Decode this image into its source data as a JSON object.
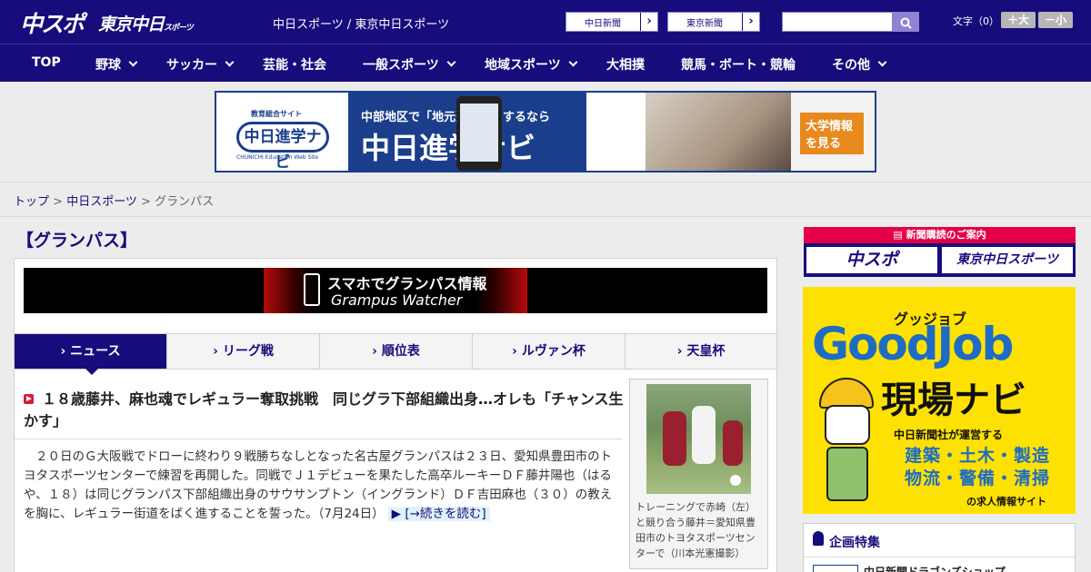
{
  "header": {
    "logo_chuspo": "中スポ",
    "logo_tokyo": "東京中日",
    "logo_tokyo_small": "スポーツ",
    "title": "中日スポーツ / 東京中日スポーツ",
    "btn_chunichi": "中日新聞",
    "btn_tokyo": "東京新聞",
    "arrow": "›",
    "search_placeholder": "",
    "moji_label": "文字（0）",
    "font_plus": "＋大",
    "font_minus": "－小"
  },
  "nav": {
    "items": [
      {
        "label": "TOP"
      },
      {
        "label": "野球"
      },
      {
        "label": "サッカー"
      },
      {
        "label": "芸能・社会"
      },
      {
        "label": "一般スポーツ"
      },
      {
        "label": "地域スポーツ"
      },
      {
        "label": "大相撲"
      },
      {
        "label": "競馬・ボート・競輪"
      },
      {
        "label": "その他"
      }
    ]
  },
  "banner": {
    "badge": "教育総合サイト",
    "logo": "中日進学ナビ",
    "logo_en": "CHUNICHI Education Web Site",
    "line1": "中部地区で「地元進学」をするなら",
    "line2": "中日進学ナビ",
    "cta": "大学情報を見る"
  },
  "breadcrumb": {
    "top": "トップ",
    "chuspo": "中日スポーツ",
    "current": "グランパス",
    "sep": " > "
  },
  "section_title": "【グランパス】",
  "grampus_banner": {
    "line1": "スマホでグランパス情報",
    "line2": "Grampus Watcher"
  },
  "tabs": [
    {
      "label": "ニュース"
    },
    {
      "label": "リーグ戦"
    },
    {
      "label": "順位表"
    },
    {
      "label": "ルヴァン杯"
    },
    {
      "label": "天皇杯"
    }
  ],
  "article": {
    "headline": "１８歳藤井、麻也魂でレギュラー奪取挑戦　同じグラ下部組織出身…オレも「チャンス生かす」",
    "body": "２０日のＧ大阪戦でドローに終わり９戦勝ちなしとなった名古屋グランパスは２３日、愛知県豊田市のトヨタスポーツセンターで練習を再開した。同戦でＪ１デビューを果たした高卒ルーキーＤＦ藤井陽也（はるや、１８）は同じグランパス下部組織出身のサウサンプトン（イングランド）ＤＦ吉田麻也（３０）の教えを胸に、レギュラー街道をばく進することを誓った。",
    "date": "（7月24日）",
    "more": "[→続きを読む]",
    "photo_caption": "トレーニングで赤崎（左）と競り合う藤井＝愛知県豊田市のトヨタスポーツセンターで（川本光憲撮影）"
  },
  "sidebar": {
    "subscribe_title": "新聞購読のご案内",
    "sub_chuspo": "中スポ",
    "sub_tokyo": "東京中日スポーツ",
    "goodjob_sub": "グッジョブ",
    "goodjob_big": "GoodJob",
    "goodjob_title": "現場ナビ",
    "goodjob_by": "中日新聞社が運営する",
    "goodjob_fields1": "建築・土木・製造",
    "goodjob_fields2": "物流・警備・清掃",
    "goodjob_foot": "の求人情報サイト",
    "feature_title": "企画特集",
    "feature_item": "中日新聞ドラゴンズショップ"
  },
  "colors": {
    "brand": "#170c7c",
    "accent": "#e40046"
  }
}
